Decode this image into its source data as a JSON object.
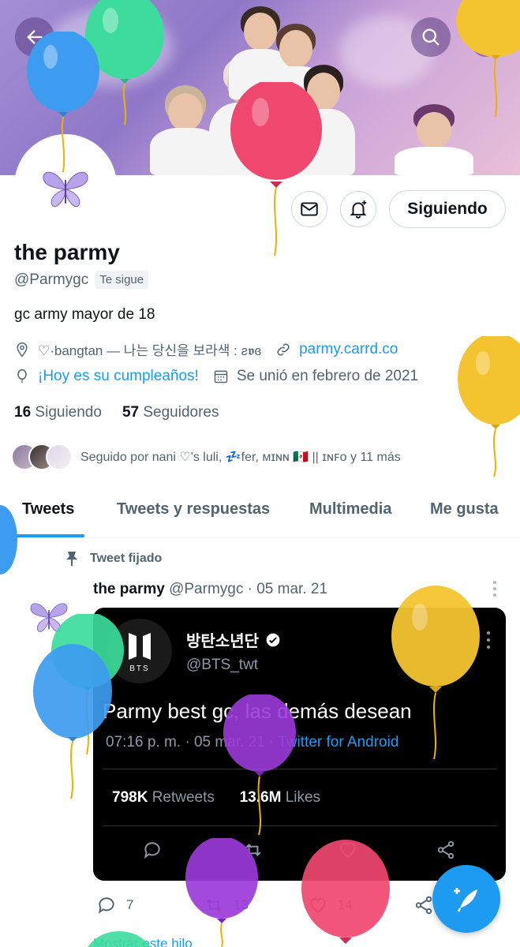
{
  "profile": {
    "name": "the parmy",
    "handle": "@Parmygc",
    "follows_you_label": "Te sigue",
    "bio": "gc army mayor de 18",
    "location": "♡·bangtan — 나는 당신을 보라색 : ƨ𝖛ɞ",
    "website": "parmy.carrd.co",
    "birthday": "¡Hoy es su cumpleaños!",
    "joined": "Se unió en febrero de 2021",
    "following_count": "16",
    "following_label": "Siguiendo",
    "followers_count": "57",
    "followers_label": "Seguidores",
    "followed_by": "Seguido por nani ♡'s luli, 💤fer, ᴍɪɴɴ 🇲🇽 || ɪɴꜰᴏ y 11 más"
  },
  "actions": {
    "following_button": "Siguiendo"
  },
  "tabs": [
    {
      "label": "Tweets",
      "active": true
    },
    {
      "label": "Tweets y respuestas",
      "active": false
    },
    {
      "label": "Multimedia",
      "active": false
    },
    {
      "label": "Me gusta",
      "active": false
    }
  ],
  "pinned_tweet": {
    "pinned_label": "Tweet fijado",
    "author_name": "the parmy",
    "author_handle": "@Parmygc",
    "date": "· 05 mar. 21",
    "replies": "7",
    "retweets": "13",
    "likes": "14",
    "show_thread": "Mostrar este hilo",
    "embedded": {
      "name": "방탄소년단",
      "handle": "@BTS_twt",
      "logo_text": "BTS",
      "text": "Parmy best gc, las demás desean",
      "time": "07:16 p. m. · 05 mar. 21 ·",
      "client": "Twitter for Android",
      "retweets_count": "798K",
      "retweets_label": "Retweets",
      "likes_count": "13.6M",
      "likes_label": "Likes"
    }
  },
  "colors": {
    "accent": "#1d9bf0",
    "balloon_teal": "#3ddc9c",
    "balloon_blue": "#3d9cf0",
    "balloon_pink": "#f0476e",
    "balloon_yellow": "#f4c430",
    "balloon_purple": "#9b3bd9"
  },
  "icons": [
    "back-arrow-icon",
    "search-icon",
    "more-icon",
    "mail-icon",
    "bell-plus-icon",
    "location-icon",
    "link-icon",
    "balloon-icon",
    "calendar-icon",
    "pin-icon",
    "reply-icon",
    "retweet-icon",
    "heart-icon",
    "share-icon",
    "compose-icon",
    "verified-icon",
    "butterfly-icon"
  ]
}
